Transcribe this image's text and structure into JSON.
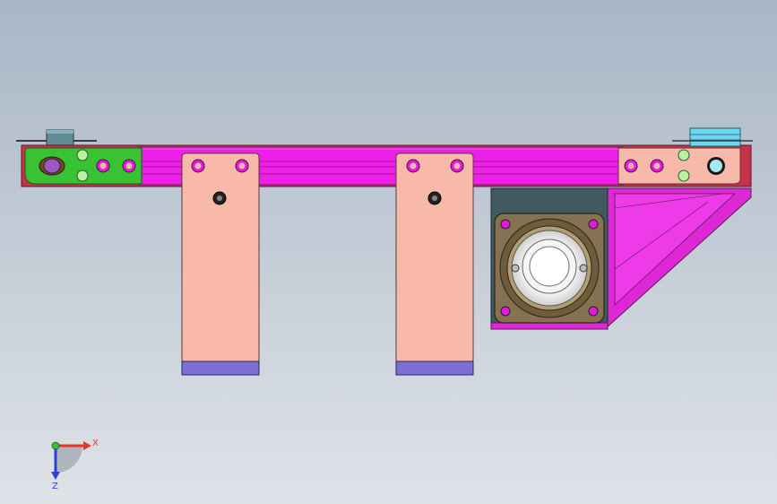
{
  "viewport": {
    "background_top": "#a9b6c6",
    "background_bottom": "#dfe3e8"
  },
  "triad": {
    "x_label": "X",
    "z_label": "Z",
    "x_color": "#e8342e",
    "z_color": "#2f3fd4",
    "y_color": "#3cbf3c"
  },
  "colors": {
    "beam": "#ee1fe8",
    "beam_edge": "#7a1a70",
    "frame_red": "#c4334a",
    "plate": "#f9b9aa",
    "plate_edge": "#5a3a38",
    "foot": "#7b6fd6",
    "green_block": "#39c233",
    "bracket": "#de28d6",
    "motor_flange": "#857250",
    "motor_body": "#3f5a60",
    "cyan_block": "#6fd8f0",
    "hole_fill": "#e817e0",
    "light_green": "#b9f2a2"
  }
}
